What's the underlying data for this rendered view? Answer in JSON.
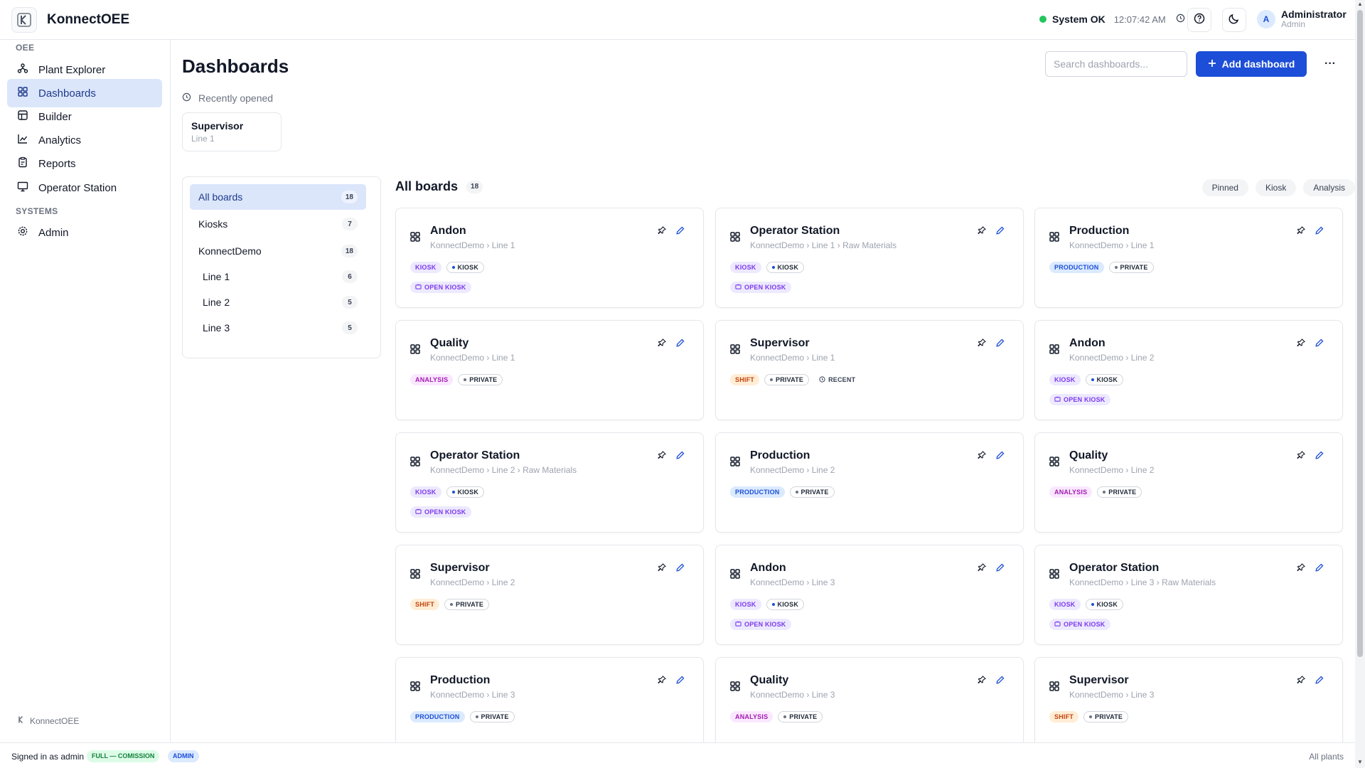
{
  "app": {
    "title": "KonnectOEE"
  },
  "header": {
    "status": "System OK",
    "time": "12:07:42 AM",
    "user": {
      "initial": "A",
      "name": "Administrator",
      "role": "Admin"
    }
  },
  "sidebar": {
    "sections": [
      {
        "label": "OEE",
        "items": [
          {
            "label": "Plant Explorer",
            "icon": "hierarchy-icon",
            "active": false
          },
          {
            "label": "Dashboards",
            "icon": "dashboard-grid-icon",
            "active": true
          },
          {
            "label": "Builder",
            "icon": "builder-grid-icon",
            "active": false
          },
          {
            "label": "Analytics",
            "icon": "chart-icon",
            "active": false
          },
          {
            "label": "Reports",
            "icon": "clipboard-icon",
            "active": false
          },
          {
            "label": "Operator Station",
            "icon": "monitor-icon",
            "active": false
          }
        ]
      },
      {
        "label": "SYSTEMS",
        "items": [
          {
            "label": "Admin",
            "icon": "gear-icon",
            "active": false
          }
        ]
      }
    ],
    "footer": "KonnectOEE"
  },
  "main": {
    "title": "Dashboards",
    "search_placeholder": "Search dashboards...",
    "add_label": "Add dashboard",
    "more_label": "···",
    "recent_label": "Recently opened",
    "recent": [
      {
        "title": "Supervisor",
        "subtitle": "Line 1"
      }
    ],
    "filters": [
      {
        "label": "All boards",
        "count": "18",
        "active": true,
        "sub": false
      },
      {
        "label": "Kiosks",
        "count": "7",
        "active": false,
        "sub": false
      },
      {
        "label": "KonnectDemo",
        "count": "18",
        "active": false,
        "sub": false
      },
      {
        "label": "Line 1",
        "count": "6",
        "active": false,
        "sub": true
      },
      {
        "label": "Line 2",
        "count": "5",
        "active": false,
        "sub": true
      },
      {
        "label": "Line 3",
        "count": "5",
        "active": false,
        "sub": true
      }
    ],
    "boards_title": "All boards",
    "boards_count": "18",
    "chips": [
      "Pinned",
      "Kiosk",
      "Analysis"
    ],
    "cards": [
      {
        "title": "Andon",
        "path": "KonnectDemo › Line 1",
        "tags": [
          {
            "t": "KIOSK",
            "k": "kiosk"
          },
          {
            "t": "KIOSK",
            "k": "outline"
          }
        ],
        "open": "OPEN KIOSK"
      },
      {
        "title": "Operator Station",
        "path": "KonnectDemo › Line 1 › Raw Materials",
        "tags": [
          {
            "t": "KIOSK",
            "k": "kiosk"
          },
          {
            "t": "KIOSK",
            "k": "outline"
          }
        ],
        "open": "OPEN KIOSK"
      },
      {
        "title": "Production",
        "path": "KonnectDemo › Line 1",
        "tags": [
          {
            "t": "PRODUCTION",
            "k": "production"
          },
          {
            "t": "PRIVATE",
            "k": "outline"
          }
        ],
        "open": ""
      },
      {
        "title": "Quality",
        "path": "KonnectDemo › Line 1",
        "tags": [
          {
            "t": "ANALYSIS",
            "k": "analysis"
          },
          {
            "t": "PRIVATE",
            "k": "outline"
          }
        ],
        "open": ""
      },
      {
        "title": "Supervisor",
        "path": "KonnectDemo › Line 1",
        "tags": [
          {
            "t": "SHIFT",
            "k": "shift"
          },
          {
            "t": "PRIVATE",
            "k": "outline"
          },
          {
            "t": "RECENT",
            "k": "plain"
          }
        ],
        "open": ""
      },
      {
        "title": "Andon",
        "path": "KonnectDemo › Line 2",
        "tags": [
          {
            "t": "KIOSK",
            "k": "kiosk"
          },
          {
            "t": "KIOSK",
            "k": "outline"
          }
        ],
        "open": "OPEN KIOSK"
      },
      {
        "title": "Operator Station",
        "path": "KonnectDemo › Line 2 › Raw Materials",
        "tags": [
          {
            "t": "KIOSK",
            "k": "kiosk"
          },
          {
            "t": "KIOSK",
            "k": "outline"
          }
        ],
        "open": "OPEN KIOSK"
      },
      {
        "title": "Production",
        "path": "KonnectDemo › Line 2",
        "tags": [
          {
            "t": "PRODUCTION",
            "k": "production"
          },
          {
            "t": "PRIVATE",
            "k": "outline"
          }
        ],
        "open": ""
      },
      {
        "title": "Quality",
        "path": "KonnectDemo › Line 2",
        "tags": [
          {
            "t": "ANALYSIS",
            "k": "analysis"
          },
          {
            "t": "PRIVATE",
            "k": "outline"
          }
        ],
        "open": ""
      },
      {
        "title": "Supervisor",
        "path": "KonnectDemo › Line 2",
        "tags": [
          {
            "t": "SHIFT",
            "k": "shift"
          },
          {
            "t": "PRIVATE",
            "k": "outline"
          }
        ],
        "open": ""
      },
      {
        "title": "Andon",
        "path": "KonnectDemo › Line 3",
        "tags": [
          {
            "t": "KIOSK",
            "k": "kiosk"
          },
          {
            "t": "KIOSK",
            "k": "outline"
          }
        ],
        "open": "OPEN KIOSK"
      },
      {
        "title": "Operator Station",
        "path": "KonnectDemo › Line 3 › Raw Materials",
        "tags": [
          {
            "t": "KIOSK",
            "k": "kiosk"
          },
          {
            "t": "KIOSK",
            "k": "outline"
          }
        ],
        "open": "OPEN KIOSK"
      },
      {
        "title": "Production",
        "path": "KonnectDemo › Line 3",
        "tags": [
          {
            "t": "PRODUCTION",
            "k": "production"
          },
          {
            "t": "PRIVATE",
            "k": "outline"
          }
        ],
        "open": ""
      },
      {
        "title": "Quality",
        "path": "KonnectDemo › Line 3",
        "tags": [
          {
            "t": "ANALYSIS",
            "k": "analysis"
          },
          {
            "t": "PRIVATE",
            "k": "outline"
          }
        ],
        "open": ""
      },
      {
        "title": "Supervisor",
        "path": "KonnectDemo › Line 3",
        "tags": [
          {
            "t": "SHIFT",
            "k": "shift"
          },
          {
            "t": "PRIVATE",
            "k": "outline"
          }
        ],
        "open": ""
      }
    ]
  },
  "footer": {
    "signed_in": "Signed in as admin",
    "badge_license": "FULL — COMISSION",
    "badge_role": "ADMIN",
    "scope": "All plants"
  },
  "colors": {
    "accent": "#1d4ed8",
    "active_bg": "#dbe6fb",
    "status_ok": "#22c55e"
  }
}
